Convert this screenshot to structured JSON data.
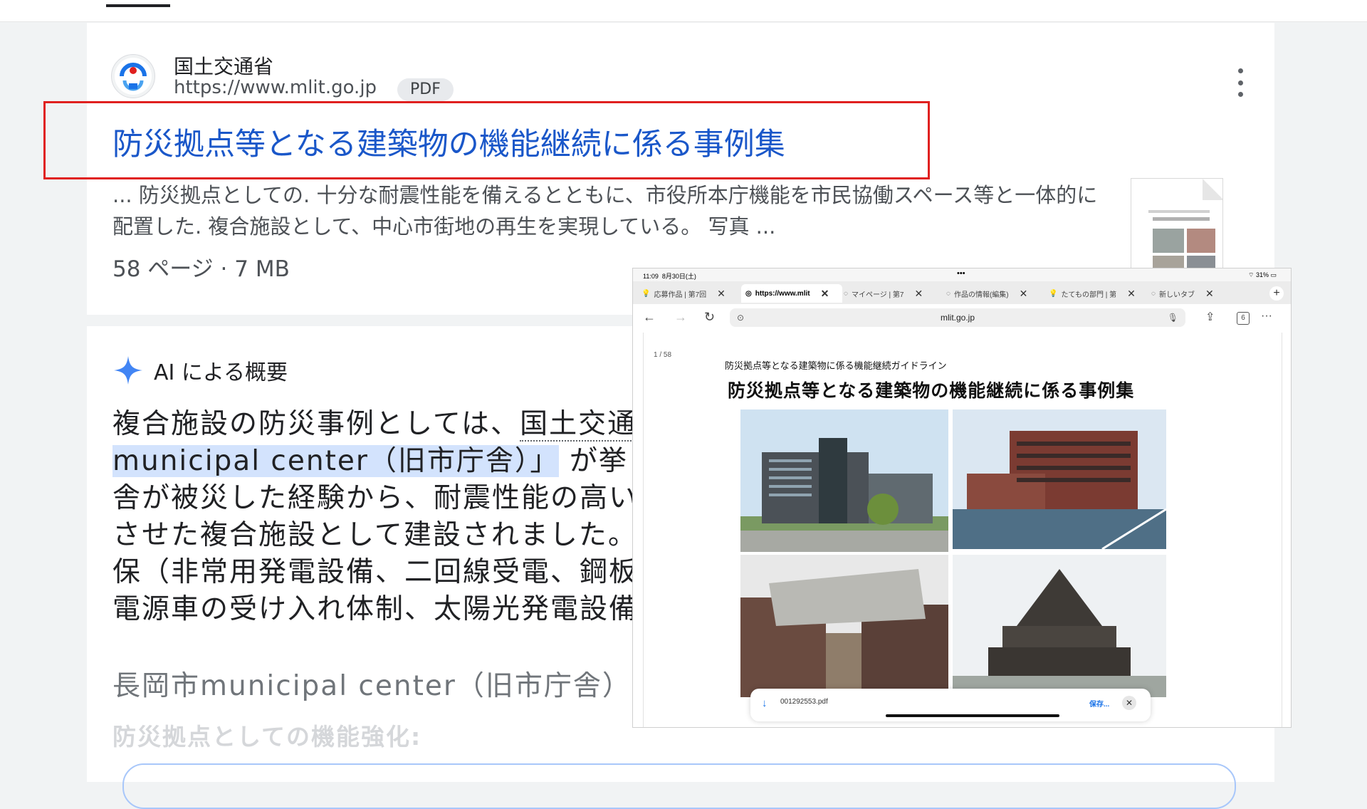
{
  "result": {
    "site_name": "国土交通省",
    "url": "https://www.mlit.go.jp",
    "badge": "PDF",
    "title": "防災拠点等となる建築物の機能継続に係る事例集",
    "snippet": "... 防災拠点としての. 十分な耐震性能を備えるとともに、市役所本庁機能を市民協働スペース等と一体的に配置した. 複合施設として、中心市街地の再生を実現している。 写真 ...",
    "meta": "58 ページ · 7 MB"
  },
  "ai_overview": {
    "heading": "AI による概要",
    "lines": [
      {
        "text": "複合施設の防災事例としては、",
        "link": "国土交通"
      },
      {
        "highlight": "municipal center（旧市庁舎）」",
        "rest": "が挙"
      },
      {
        "text": "舎が被災した経験から、耐震性能の高い"
      },
      {
        "text": "させた複合施設として建設されました。"
      },
      {
        "text": "保（非常用発電設備、二回線受電、鋼板"
      },
      {
        "text": "電源車の受け入れ体制、太陽光発電設備"
      }
    ],
    "subheading": "長岡市municipal center（旧市庁舎）",
    "faded": "防災拠点としての機能強化:"
  },
  "inset": {
    "status": {
      "time": "11:09",
      "date": "8月30日(土)",
      "dots": "•••",
      "battery": "31%"
    },
    "tabs": [
      {
        "label": "応募作品 | 第7回"
      },
      {
        "label": "https://www.mlit",
        "active": true
      },
      {
        "label": "マイページ | 第7"
      },
      {
        "label": "作品の情報(編集)"
      },
      {
        "label": "たてもの部門 | 第"
      },
      {
        "label": "新しいタブ"
      }
    ],
    "address": "mlit.go.jp",
    "tab_count": "6",
    "page_indicator": "1 / 58",
    "pdf_subtitle": "防災拠点等となる建築物に係る機能継続ガイドライン",
    "pdf_title": "防災拠点等となる建築物の機能継続に係る事例集",
    "download": {
      "filename": "001292553.pdf",
      "save_label": "保存..."
    }
  },
  "colors": {
    "link_blue": "#1a57c9",
    "red_annotation": "#e0201f",
    "highlight": "#d3e3fd",
    "ai_star": "#4285f4"
  },
  "icons": [
    "favicon-icon",
    "more-vert-icon",
    "sparkle-icon",
    "back-icon",
    "forward-icon",
    "reload-icon",
    "share-icon",
    "download-icon",
    "close-icon",
    "plus-icon"
  ]
}
